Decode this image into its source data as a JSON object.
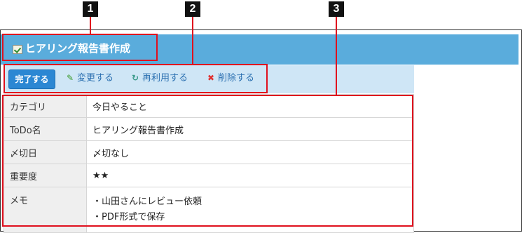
{
  "title": "ヒアリング報告書作成",
  "title_icon": "todo-check-icon",
  "toolbar": {
    "complete_label": "完了する",
    "edit_label": "変更する",
    "reuse_label": "再利用する",
    "delete_label": "削除する"
  },
  "details": {
    "category": {
      "label": "カテゴリ",
      "value": "今日やること"
    },
    "todo_name": {
      "label": "ToDo名",
      "value": "ヒアリング報告書作成"
    },
    "due_date": {
      "label": "〆切日",
      "value": "〆切なし"
    },
    "priority": {
      "label": "重要度",
      "value": "★★"
    },
    "memo": {
      "label": "メモ",
      "lines": [
        "・山田さんにレビュー依頼",
        "・PDF形式で保存"
      ]
    }
  },
  "callouts": [
    "1",
    "2",
    "3"
  ],
  "colors": {
    "title_bar": "#5aacdc",
    "toolbar_bg": "#cfe6f6",
    "complete_button": "#2b87d3",
    "link": "#2a6fb0",
    "highlight": "#e0101e"
  },
  "icons": {
    "edit": "pencil-icon",
    "reuse": "reuse-icon",
    "delete": "delete-x-icon"
  }
}
